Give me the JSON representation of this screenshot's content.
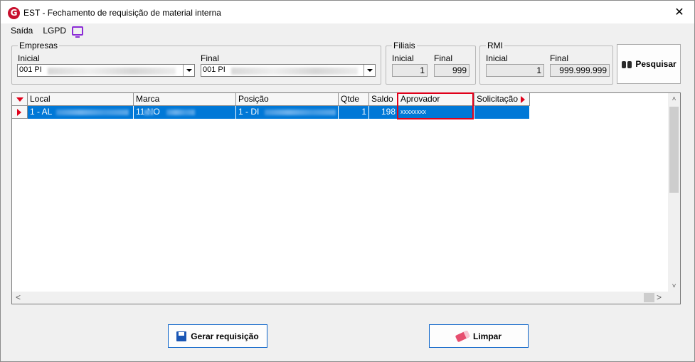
{
  "window": {
    "title": "EST - Fechamento de requisição de material interna",
    "app_icon_letter": "G",
    "close_glyph": "✕"
  },
  "menu": {
    "saida": "Saída",
    "lgpd": "LGPD"
  },
  "empresas": {
    "legend": "Empresas",
    "inicial_label": "Inicial",
    "inicial_value": "001 PI",
    "final_label": "Final",
    "final_value": "001 PI"
  },
  "filiais": {
    "legend": "Filiais",
    "inicial_label": "Inicial",
    "inicial_value": "1",
    "final_label": "Final",
    "final_value": "999"
  },
  "rmi": {
    "legend": "RMI",
    "inicial_label": "Inicial",
    "inicial_value": "1",
    "final_label": "Final",
    "final_value": "999.999.999"
  },
  "pesquisar_label": "Pesquisar",
  "grid": {
    "columns": [
      "Local",
      "Marca",
      "Posição",
      "Qtde",
      "Saldo",
      "Aprovador",
      "Solicitação"
    ],
    "rows": [
      {
        "local": "1 - AL",
        "marca": "11 NO",
        "posicao": "1 - DI",
        "qtde": "1",
        "saldo": "198",
        "aprovador": "xxxxxxxx",
        "solicitacao": ""
      }
    ]
  },
  "footer": {
    "gerar_label": "Gerar requisição",
    "limpar_label": "Limpar"
  },
  "colors": {
    "selection": "#0078d7",
    "highlight_border": "#e0001a",
    "brand_icon": "#c8102e",
    "lgpd_icon": "#8b2bd6"
  },
  "icons": {
    "app": "app-logo-icon",
    "close": "close-icon",
    "lgpd": "monitor-icon",
    "pesquisar": "binoculars-icon",
    "gerar": "save-disk-icon",
    "limpar": "eraser-icon"
  }
}
